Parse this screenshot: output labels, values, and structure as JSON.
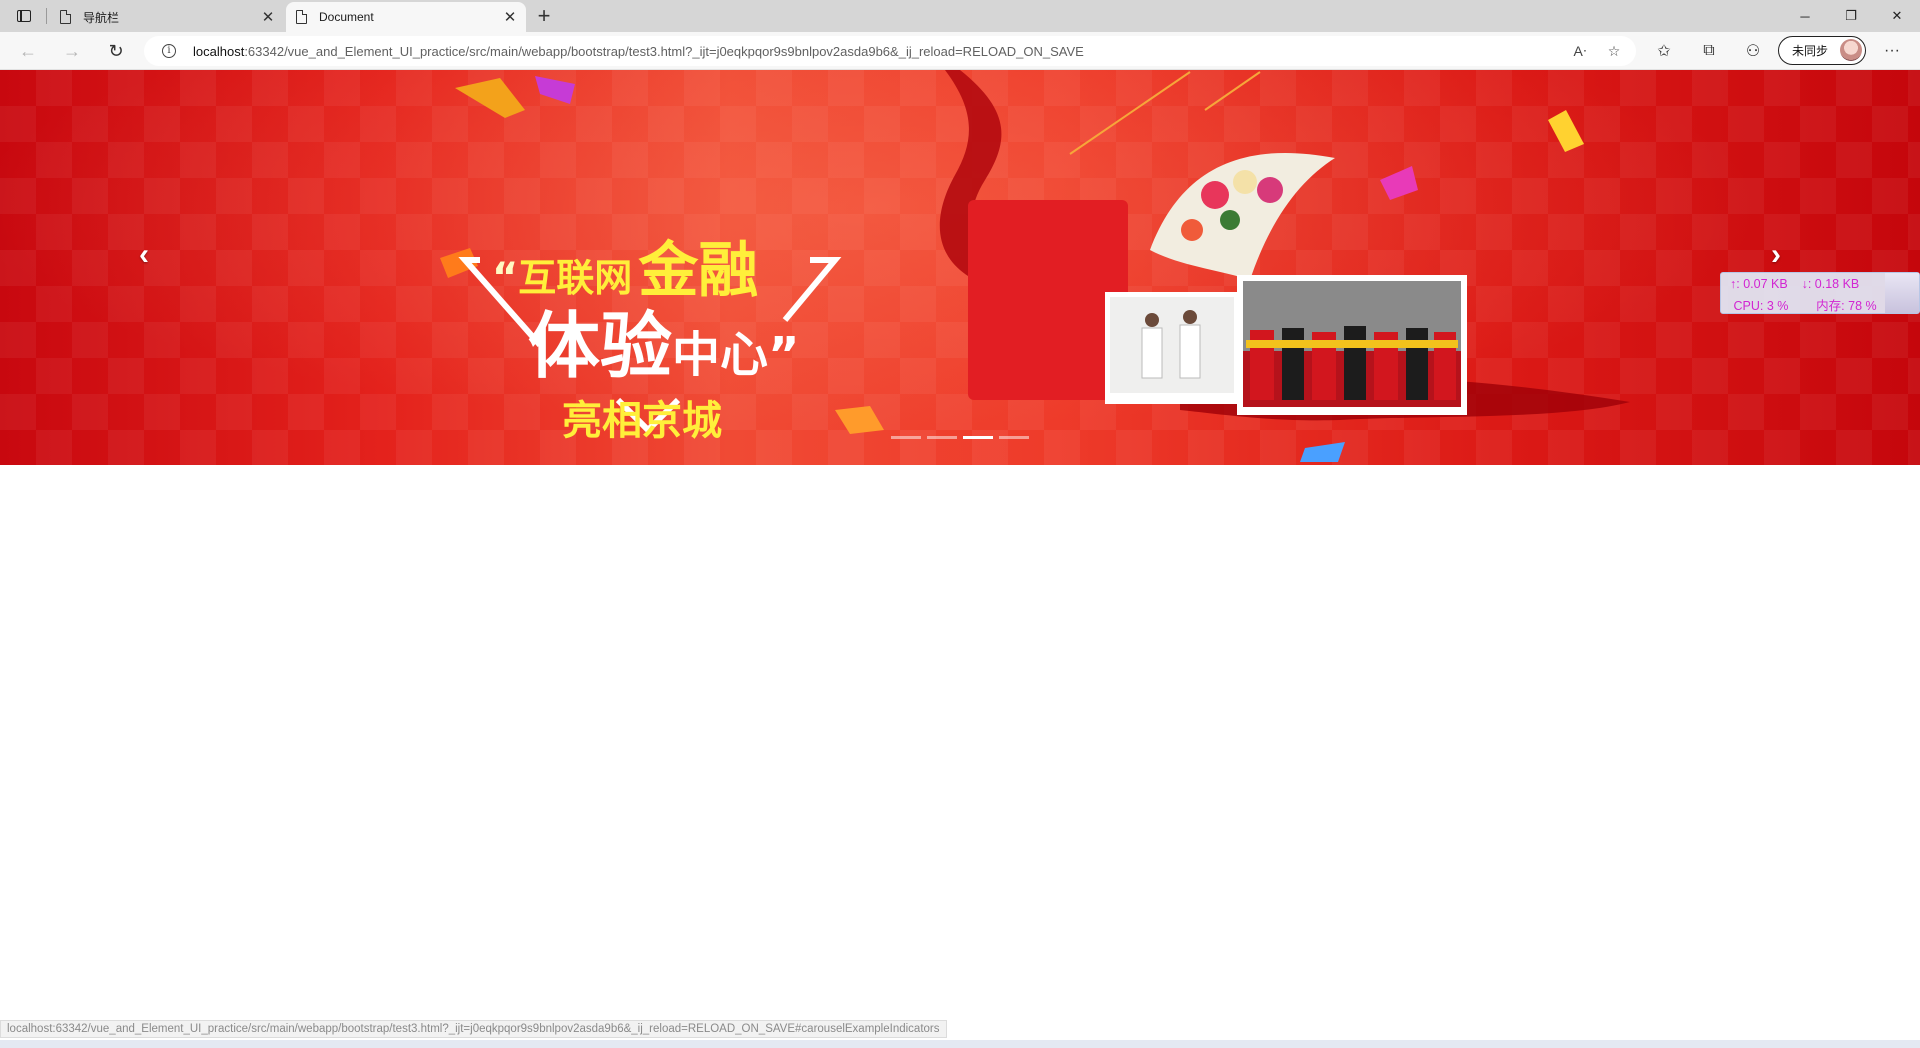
{
  "browser": {
    "tabs": [
      {
        "title": "导航栏",
        "active": false
      },
      {
        "title": "Document",
        "active": true
      }
    ],
    "new_tab_label": "+",
    "window_controls": {
      "minimize": "─",
      "restore": "❐",
      "close": "✕"
    },
    "address": {
      "host": "localhost",
      "rest": ":63342/vue_and_Element_UI_practice/src/main/webapp/bootstrap/test3.html?_ijt=j0eqkpqor9s9bnlpov2asda9b6&_ij_reload=RELOAD_ON_SAVE"
    },
    "sync_label": "未同步",
    "toolbar_icons": [
      "read-aloud-icon",
      "add-favorite-icon",
      "favorites-icon",
      "collections-icon",
      "extensions-icon",
      "more-icon"
    ]
  },
  "carousel": {
    "banner": {
      "quote_open": "“",
      "line1_small": "互联网",
      "line1_big": "金融",
      "line2_big": "体验",
      "line2_mid": "中心",
      "quote_close": "”",
      "line3": "亮相京城"
    },
    "prev_label": "‹",
    "next_label": "›",
    "indicator_count": 4,
    "active_indicator": 3,
    "colors": {
      "background": "#e4221c",
      "headline_yellow": "#ffef3a"
    }
  },
  "monitor": {
    "upload": "↑: 0.07 KB",
    "download": "↓: 0.18 KB",
    "cpu": "CPU: 3 %",
    "memory": "内存: 78 %"
  },
  "status": {
    "link_url": "localhost:63342/vue_and_Element_UI_practice/src/main/webapp/bootstrap/test3.html?_ijt=j0eqkpqor9s9bnlpov2asda9b6&_ij_reload=RELOAD_ON_SAVE#carouselExampleIndicators"
  }
}
